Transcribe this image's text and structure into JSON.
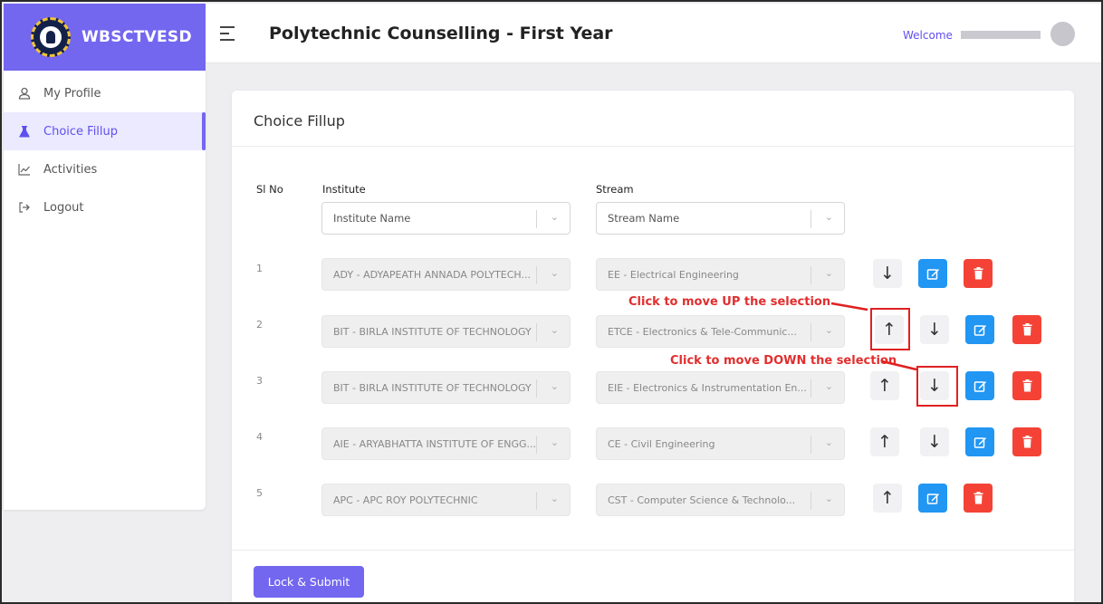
{
  "brand": {
    "name": "WBSCTVESD"
  },
  "header": {
    "title": "Polytechnic Counselling - First Year",
    "welcome": "Welcome"
  },
  "sidebar": {
    "items": [
      {
        "label": "My Profile",
        "icon": "user-icon",
        "active": false
      },
      {
        "label": "Choice Fillup",
        "icon": "flask-icon",
        "active": true
      },
      {
        "label": "Activities",
        "icon": "chart-line-icon",
        "active": false
      },
      {
        "label": "Logout",
        "icon": "logout-icon",
        "active": false
      }
    ]
  },
  "card": {
    "title": "Choice Fillup",
    "headers": {
      "sl": "Sl No",
      "institute": "Institute",
      "stream": "Stream"
    },
    "filters": {
      "institute_placeholder": "Institute Name",
      "stream_placeholder": "Stream Name"
    },
    "rows": [
      {
        "sl": "1",
        "institute": "ADY - ADYAPEATH ANNADA POLYTECH...",
        "stream": "EE - Electrical Engineering",
        "up": false,
        "down": true
      },
      {
        "sl": "2",
        "institute": "BIT - BIRLA INSTITUTE OF TECHNOLOGY",
        "stream": "ETCE - Electronics & Tele-Communic...",
        "up": true,
        "down": true
      },
      {
        "sl": "3",
        "institute": "BIT - BIRLA INSTITUTE OF TECHNOLOGY",
        "stream": "EIE - Electronics & Instrumentation En...",
        "up": true,
        "down": true
      },
      {
        "sl": "4",
        "institute": "AIE - ARYABHATTA INSTITUTE OF ENGG...",
        "stream": "CE - Civil Engineering",
        "up": true,
        "down": true
      },
      {
        "sl": "5",
        "institute": "APC - APC ROY POLYTECHNIC",
        "stream": "CST - Computer Science & Technolo...",
        "up": true,
        "down": false
      }
    ],
    "submit_label": "Lock & Submit"
  },
  "annotations": {
    "up": "Click to move UP the selection",
    "down": "Click to move DOWN the selection"
  },
  "colors": {
    "primary": "#7367f0",
    "edit": "#2196f3",
    "delete": "#f44336",
    "annotation": "#e02020"
  }
}
